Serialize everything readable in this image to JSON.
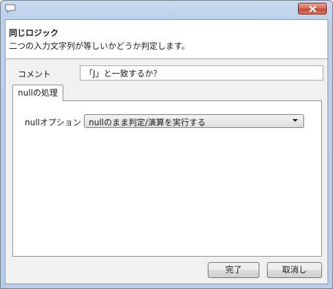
{
  "titlebar": {
    "icon": "speech-bubble-icon",
    "close_icon": "close-icon"
  },
  "header": {
    "title": "同じロジック",
    "description": "二つの入力文字列が等しいかどうか判定します。"
  },
  "comment": {
    "label": "コメント",
    "value": "「J」と一致するか？"
  },
  "tabs": [
    {
      "label": "nullの処理",
      "selected": true
    }
  ],
  "null_option": {
    "label": "nullオプション",
    "selected": "nullのまま判定/演算を実行する"
  },
  "buttons": {
    "ok": "完了",
    "cancel": "取消し"
  },
  "colors": {
    "close_button": "#d9705d",
    "frame": "#bcd0ea"
  }
}
